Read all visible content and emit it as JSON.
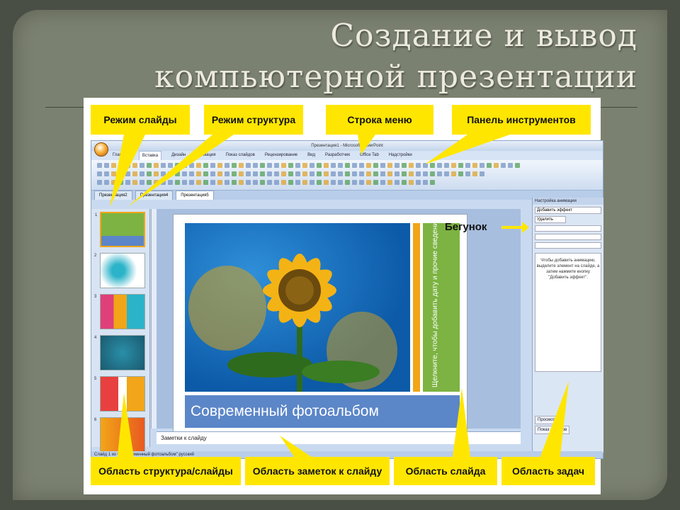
{
  "title": {
    "line1": "Создание и вывод",
    "line2": "компьютерной презентации"
  },
  "callouts": {
    "slides_mode": "Режим слайды",
    "outline_mode": "Режим структура",
    "menu_bar": "Строка меню",
    "toolbar": "Панель инструментов",
    "slider": "Бегунок",
    "outline_slides_area": "Область структура/слайды",
    "notes_area": "Область заметок к слайду",
    "slide_area": "Область слайда",
    "task_area": "Область задач"
  },
  "window": {
    "title": "Презентация1 - Microsoft PowerPoint",
    "tabs": [
      "Главная",
      "Вставка",
      "Дизайн",
      "Анимация",
      "Показ слайдов",
      "Рецензирование",
      "Вид",
      "Разработчик",
      "Office Tab",
      "Надстройки"
    ],
    "doc_tabs": [
      "Презентация2",
      "Презентация4",
      "Презентация5"
    ],
    "slide_caption": "Современный фотоальбом",
    "side_placeholder": "Щелкните, чтобы добавить дату и прочие сведения",
    "notes_placeholder": "Заметки к слайду",
    "status": "Слайд 1 из 6   \"Современный фотоальбом\"   русский",
    "taskpane": {
      "title": "Настройка анимации",
      "add_effect": "Добавить эффект",
      "remove": "Удалить",
      "hint": "Чтобы добавить анимацию, выделите элемент на слайде, а затем нажмите кнопку \"Добавить эффект\".",
      "preview": "Просмотр",
      "slideshow": "Показ слайдов"
    }
  },
  "colors": {
    "callout": "#ffe600",
    "background": "#7b8170",
    "caption_bar": "#5b86c8",
    "accent_green": "#7cb342",
    "accent_orange": "#f2a518"
  }
}
